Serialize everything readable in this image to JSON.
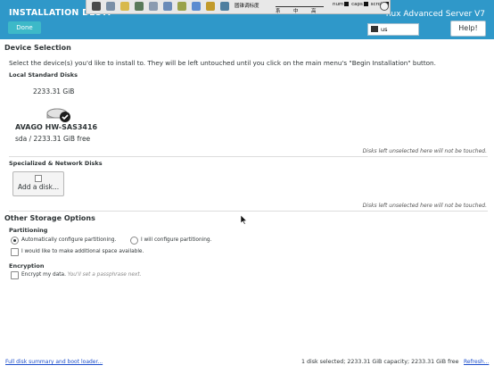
{
  "header": {
    "title": "INSTALLATION DESTI",
    "product_title": "nux Advanced Server V7",
    "done_label": "Done",
    "help_label": "Help!",
    "keyboard_layout": "us"
  },
  "overlay": {
    "ime_label": "圆锥调标度",
    "ime_chars": [
      "系",
      "中",
      "高"
    ],
    "num_label": "num",
    "caps_label": "caps",
    "scroll_label": "scroll"
  },
  "device_selection": {
    "title": "Device Selection",
    "description": "Select the device(s) you'd like to install to.  They will be left untouched until you click on the main menu's \"Begin Installation\" button.",
    "local_title": "Local Standard Disks",
    "disk": {
      "capacity": "2233.31 GiB",
      "name": "AVAGO HW-SAS3416",
      "detail": "sda  /  2233.31 GiB free",
      "selected": true
    },
    "local_hint": "Disks left unselected here will not be touched.",
    "network_title": "Specialized & Network Disks",
    "add_disk_label": "Add a disk...",
    "network_hint": "Disks left unselected here will not be touched."
  },
  "other_storage": {
    "title": "Other Storage Options",
    "partitioning_title": "Partitioning",
    "auto_label": "Automatically configure partitioning.",
    "manual_label": "I will configure partitioning.",
    "selected_option": "auto",
    "space_label": "I would like to make additional space available.",
    "encryption_title": "Encryption",
    "encrypt_label": "Encrypt my data.",
    "encrypt_hint": "You'll set a passphrase next."
  },
  "footer": {
    "summary_link": "Full disk summary and boot loader...",
    "status": "1 disk selected; 2233.31 GiB capacity; 2233.31 GiB free",
    "refresh_link": "Refresh..."
  },
  "colors": {
    "header_bg": "#2f98c9",
    "done_bg": "#3db9c8",
    "link": "#1c4ecb"
  }
}
